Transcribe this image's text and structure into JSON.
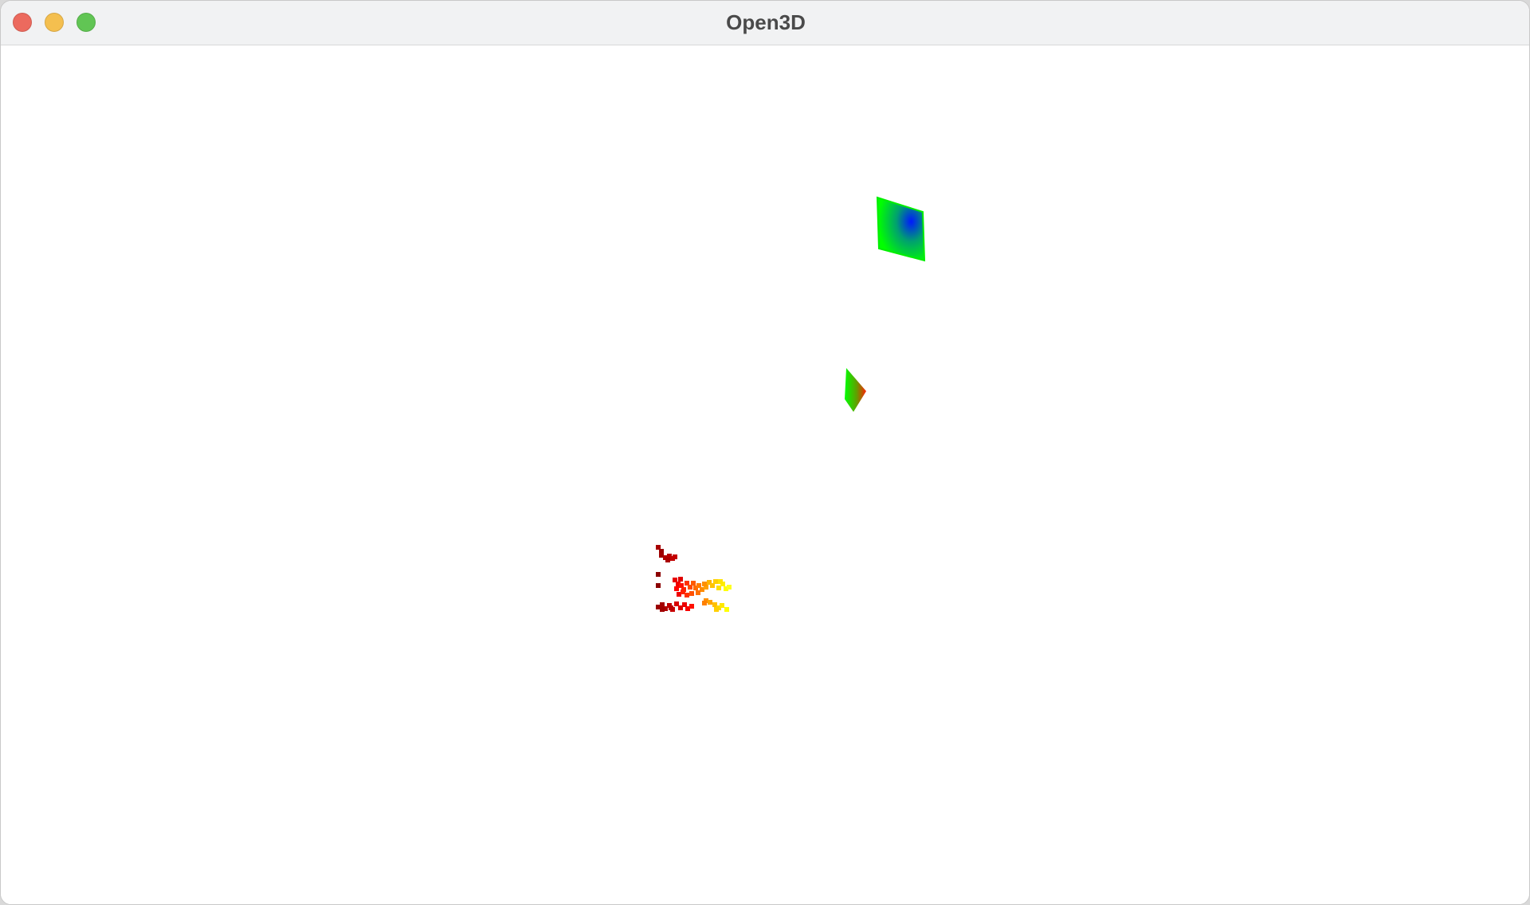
{
  "window": {
    "title": "Open3D",
    "buttons": {
      "close_color": "#ec6a5e",
      "minimize_color": "#f4bf4f",
      "zoom_color": "#61c554"
    }
  },
  "scene": {
    "background": "#ffffff",
    "objects": [
      {
        "name": "mesh-quad-green-blue",
        "colors": [
          "#00ff00",
          "#0018ff"
        ]
      },
      {
        "name": "mesh-triangle-green-red",
        "colors": [
          "#00ff00",
          "#ff2200"
        ]
      },
      {
        "name": "point-cloud-heat",
        "colors": [
          "#8b0000",
          "#ff1a00",
          "#ff8c00",
          "#ffff00"
        ]
      }
    ]
  }
}
